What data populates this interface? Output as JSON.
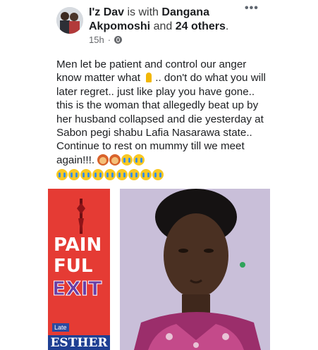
{
  "header": {
    "author": "I'z Dav",
    "with_text": "is with",
    "tagged_name": "Dangana Akpomoshi",
    "and_text": "and",
    "others": "24 others",
    "period": ".",
    "time": "15h",
    "dot": "·",
    "audience_icon": "globe-icon",
    "more_icon": "more-options-icon",
    "more_label": "•••"
  },
  "post": {
    "text": "Men let be patient and control our anger know matter what",
    "text_2": ".. don't do what you will later regret.. just like play you have gone.. this is the woman that allegedly beat up by her husband collapsed and die yesterday at Sabon pegi shabu Lafia Nasarawa state.. Continue to rest on mummy till we meet again!!!.",
    "emoji_row_count": 9
  },
  "poster": {
    "line1": "PAIN",
    "line2": "FUL",
    "line3": "EXIT",
    "late_label": "Late",
    "name": "ESTHER",
    "colors": {
      "background": "#e53b34",
      "exit": "#6a3fa6",
      "name_band": "#1e3f93"
    }
  },
  "photo": {
    "background": "#c9bfd9"
  }
}
